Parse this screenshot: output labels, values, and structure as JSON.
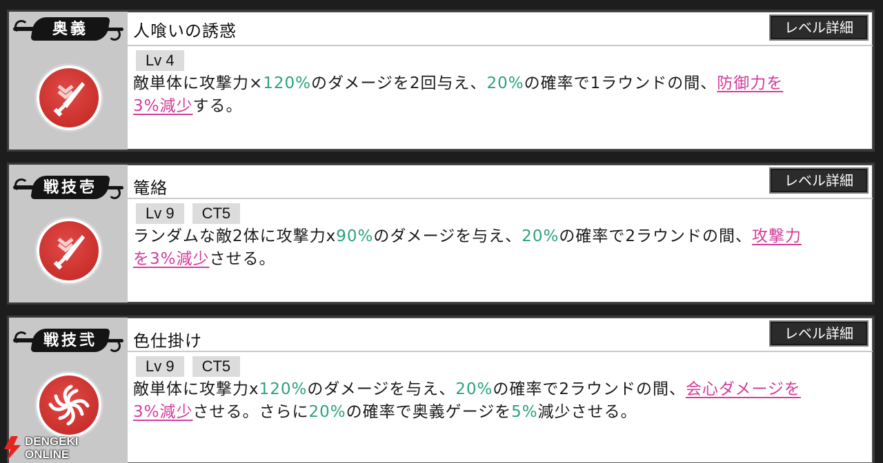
{
  "detail_button_label": "レベル詳細",
  "skills": [
    {
      "type": "奥義",
      "name": "人喰いの誘惑",
      "icon": "sword-down-icon",
      "tags": [
        "Lv 4"
      ],
      "desc": {
        "t1": "敵単体に攻撃力×",
        "n1": "120%",
        "t2": "のダメージを2回与え、",
        "n2": "20%",
        "t3": "の確率で1ラウンドの間、",
        "d1": "防御力を",
        "d2": "3%減少",
        "t4": "する。"
      }
    },
    {
      "type": "戦技壱",
      "name": "篭絡",
      "icon": "sword-down-icon",
      "tags": [
        "Lv 9",
        "CT5"
      ],
      "desc": {
        "t1": "ランダムな敵2体に攻撃力x",
        "n1": "90%",
        "t2": "のダメージを与え、",
        "n2": "20%",
        "t3": "の確率で2ラウンドの間、",
        "d1": "攻撃力",
        "d2": "を3%減少",
        "t4": "させる。"
      }
    },
    {
      "type": "戦技弐",
      "name": "色仕掛け",
      "icon": "swirl-icon",
      "tags": [
        "Lv 9",
        "CT5"
      ],
      "desc": {
        "t1": "敵単体に攻撃力x",
        "n1": "120%",
        "t2": "のダメージを与え、",
        "n2": "20%",
        "t3": "の確率で2ラウンドの間、",
        "d1": "会心ダメージを",
        "d2": "3%減少",
        "t4": "させる。さらに",
        "n3": "20%",
        "t5": "の確率で奥義ゲージを",
        "n4": "5%",
        "t6": "減少させる。"
      }
    }
  ],
  "watermark": {
    "line1": "DENGEKI",
    "line2": "ONLINE"
  },
  "colors": {
    "accent_green": "#2aa37a",
    "debuff_pink": "#d23c9a",
    "icon_red": "#c9302c"
  }
}
